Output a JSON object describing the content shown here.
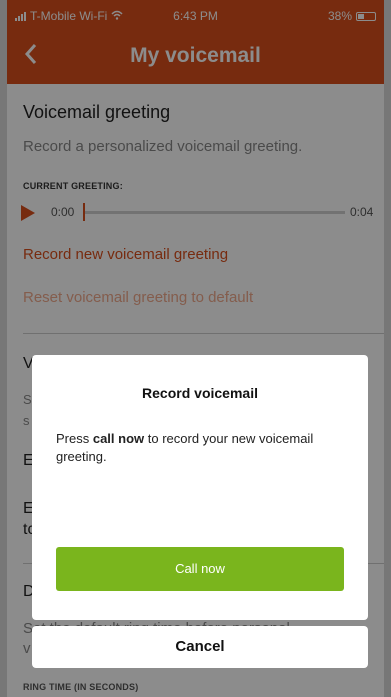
{
  "status_bar": {
    "carrier": "T-Mobile Wi-Fi",
    "time": "6:43 PM",
    "battery": "38%"
  },
  "nav": {
    "title": "My voicemail",
    "back_icon": "chevron-left-icon"
  },
  "greeting": {
    "title": "Voicemail greeting",
    "description": "Record a personalized voicemail greeting.",
    "current_label": "CURRENT GREETING:",
    "time_start": "0:00",
    "time_end": "0:04",
    "progress": 0.0,
    "record_link": "Record new voicemail greeting",
    "reset_link": "Reset voicemail greeting to default"
  },
  "background_rows": {
    "row1_title": "V",
    "row1_sub_a": "S",
    "row1_sub_b": "s",
    "row2_title": "E",
    "row3_line1": "E",
    "row3_line2": "tc",
    "row4_title": "D",
    "row4_sub": "Set the default ring time before personal",
    "row4_sub2": "v",
    "ring_time_label": "RING TIME (IN SECONDS)"
  },
  "dialog": {
    "title": "Record voicemail",
    "body_prefix": "Press ",
    "body_bold": "call now",
    "body_suffix": " to record your new voicemail greeting.",
    "call_button": "Call now",
    "cancel_button": "Cancel"
  },
  "colors": {
    "brand": "#d94f1d",
    "call_button": "#7ab51d"
  }
}
